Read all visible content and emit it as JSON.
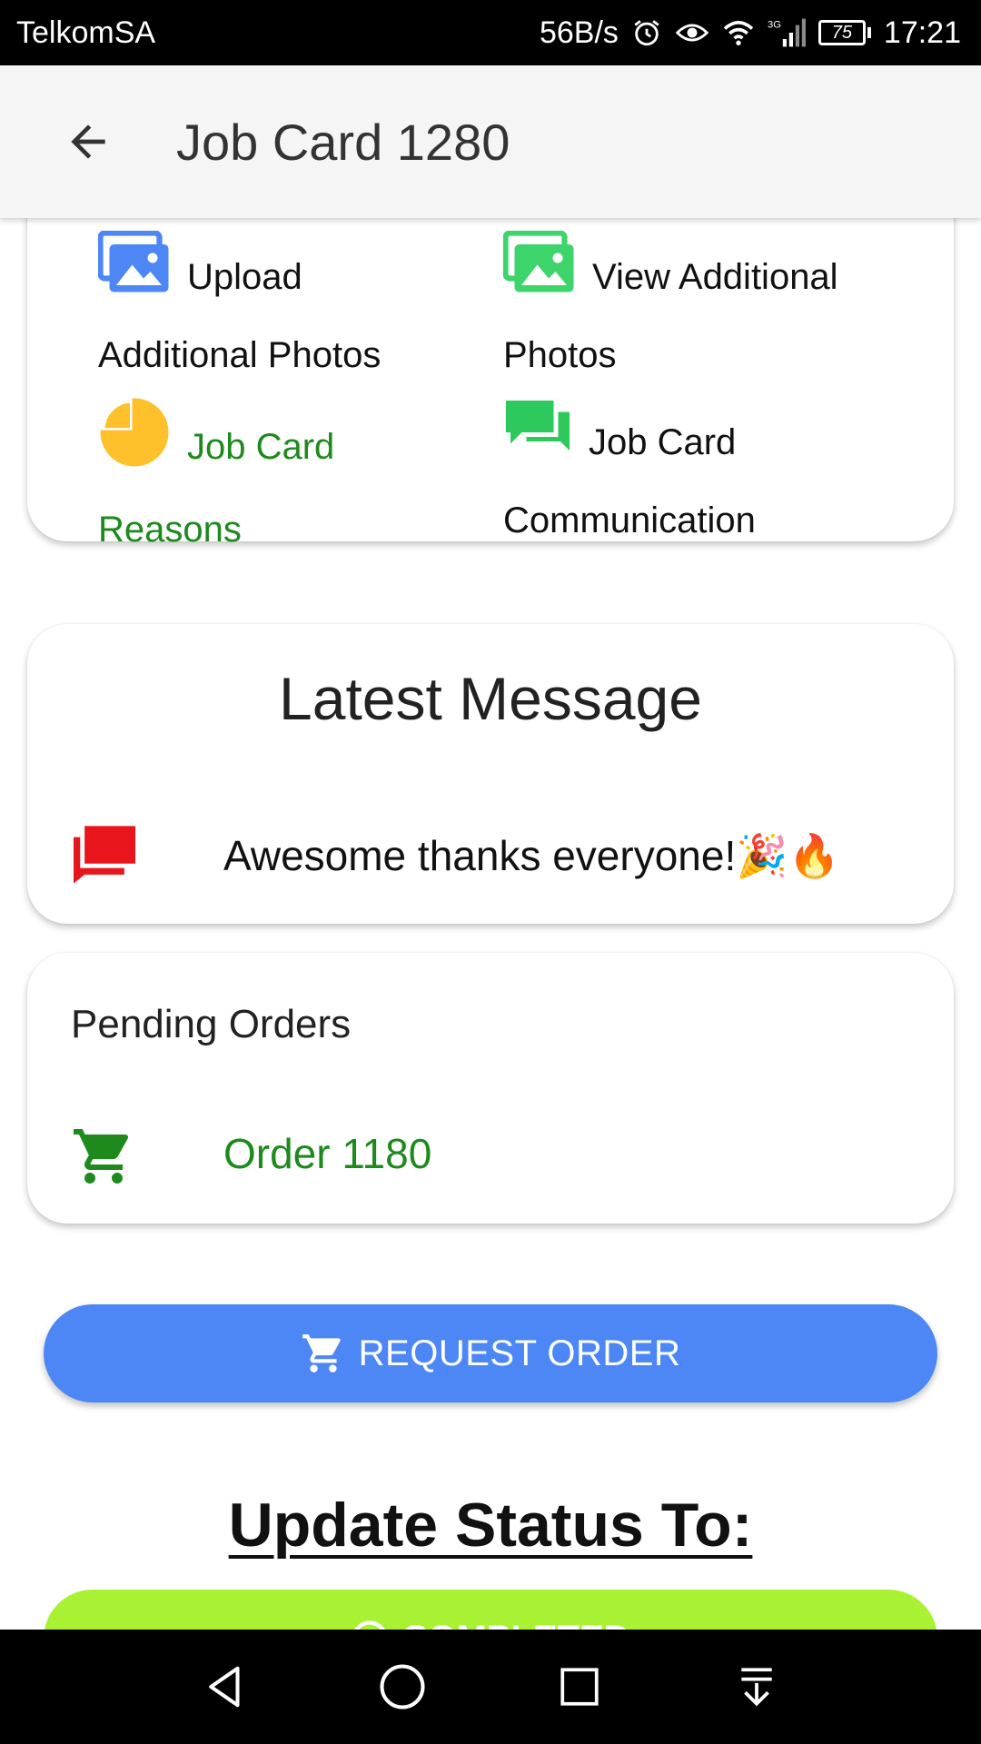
{
  "status_bar": {
    "carrier": "TelkomSA",
    "speed": "56B/s",
    "network": "3G",
    "battery": "75",
    "time": "17:21"
  },
  "app_bar": {
    "title": "Job Card 1280"
  },
  "actions": {
    "upload_photos": {
      "label": "Upload Additional Photos",
      "icon": "image-icon",
      "color": "#4c87f5"
    },
    "view_photos": {
      "label": "View Additional Photos",
      "icon": "image-icon",
      "color": "#3dd56b"
    },
    "reasons": {
      "label": "Job Card Reasons",
      "icon": "pie-chart-icon",
      "color": "#ffc12b"
    },
    "communication": {
      "label": "Job Card Communication",
      "icon": "chat-icon",
      "color": "#2ec95c"
    }
  },
  "latest_message": {
    "heading": "Latest Message",
    "text": "Awesome thanks everyone!🎉🔥",
    "icon_color": "#e8161c"
  },
  "pending_orders": {
    "title": "Pending Orders",
    "items": [
      {
        "label": "Order 1180"
      }
    ],
    "accent": "#1e8a1e"
  },
  "request_order": {
    "label": "REQUEST ORDER",
    "color": "#4c87f5"
  },
  "update_status": {
    "heading": "Update Status To:",
    "button_label": "COMPLETED",
    "button_color": "#a9f233"
  }
}
